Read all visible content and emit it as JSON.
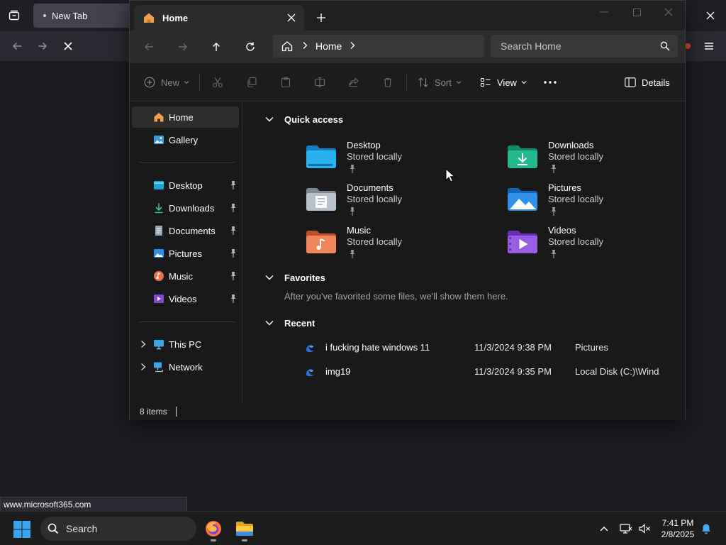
{
  "browser": {
    "tab_label": "New Tab",
    "status_url": "www.microsoft365.com"
  },
  "explorer": {
    "tab_title": "Home",
    "breadcrumb": "Home",
    "search_placeholder": "Search Home",
    "toolbar": {
      "new_label": "New",
      "sort_label": "Sort",
      "view_label": "View",
      "details_label": "Details"
    },
    "sidebar": {
      "top": [
        {
          "label": "Home",
          "icon": "home-icon",
          "selected": true
        },
        {
          "label": "Gallery",
          "icon": "gallery-icon"
        }
      ],
      "pinned": [
        {
          "label": "Desktop",
          "icon": "desktop-folder-icon"
        },
        {
          "label": "Downloads",
          "icon": "downloads-icon"
        },
        {
          "label": "Documents",
          "icon": "documents-icon"
        },
        {
          "label": "Pictures",
          "icon": "pictures-icon"
        },
        {
          "label": "Music",
          "icon": "music-icon"
        },
        {
          "label": "Videos",
          "icon": "videos-icon"
        }
      ],
      "locations": [
        {
          "label": "This PC",
          "icon": "this-pc-icon"
        },
        {
          "label": "Network",
          "icon": "network-icon"
        }
      ]
    },
    "sections": {
      "quick_access": "Quick access",
      "favorites": "Favorites",
      "favorites_empty": "After you've favorited some files, we'll show them here.",
      "recent": "Recent"
    },
    "quick_access": [
      {
        "name": "Desktop",
        "sub": "Stored locally",
        "color": "#1aa7e0"
      },
      {
        "name": "Downloads",
        "sub": "Stored locally",
        "color": "#1fb88a"
      },
      {
        "name": "Documents",
        "sub": "Stored locally",
        "color": "#b9c4cf"
      },
      {
        "name": "Pictures",
        "sub": "Stored locally",
        "color": "#2b8fe3"
      },
      {
        "name": "Music",
        "sub": "Stored locally",
        "color": "#e8704a"
      },
      {
        "name": "Videos",
        "sub": "Stored locally",
        "color": "#8b46d6"
      }
    ],
    "recent": [
      {
        "name": "i fucking hate windows 11",
        "date": "11/3/2024 9:38 PM",
        "location": "Pictures"
      },
      {
        "name": "img19",
        "date": "11/3/2024 9:35 PM",
        "location": "Local Disk (C:)\\Wind..."
      }
    ],
    "status_items": "8 items"
  },
  "taskbar": {
    "search_label": "Search",
    "time": "7:41 PM",
    "date": "2/8/2025"
  }
}
